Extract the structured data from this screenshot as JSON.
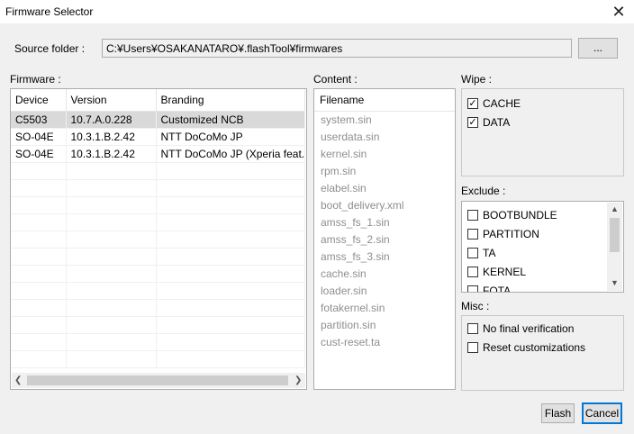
{
  "window": {
    "title": "Firmware Selector",
    "close_icon": "close-icon"
  },
  "source": {
    "label": "Source folder :",
    "path": "C:¥Users¥OSAKANATARO¥.flashTool¥firmwares",
    "browse_label": "..."
  },
  "firmware": {
    "label": "Firmware :",
    "columns": [
      "Device",
      "Version",
      "Branding"
    ],
    "rows": [
      {
        "device": "C5503",
        "version": "10.7.A.0.228",
        "branding": "Customized NCB",
        "selected": true
      },
      {
        "device": "SO-04E",
        "version": "10.3.1.B.2.42",
        "branding": "NTT DoCoMo JP"
      },
      {
        "device": "SO-04E",
        "version": "10.3.1.B.2.42",
        "branding": "NTT DoCoMo JP (Xperia feat. ..."
      }
    ]
  },
  "content": {
    "label": "Content :",
    "header": "Filename",
    "files": [
      "system.sin",
      "userdata.sin",
      "kernel.sin",
      "rpm.sin",
      "elabel.sin",
      "boot_delivery.xml",
      "amss_fs_1.sin",
      "amss_fs_2.sin",
      "amss_fs_3.sin",
      "cache.sin",
      "loader.sin",
      "fotakernel.sin",
      "partition.sin",
      "cust-reset.ta"
    ]
  },
  "wipe": {
    "label": "Wipe :",
    "items": [
      {
        "label": "CACHE",
        "checked": true
      },
      {
        "label": "DATA",
        "checked": true
      }
    ]
  },
  "exclude": {
    "label": "Exclude :",
    "items": [
      {
        "label": "BOOTBUNDLE",
        "checked": false
      },
      {
        "label": "PARTITION",
        "checked": false
      },
      {
        "label": "TA",
        "checked": false
      },
      {
        "label": "KERNEL",
        "checked": false
      },
      {
        "label": "FOTA",
        "checked": false
      }
    ]
  },
  "misc": {
    "label": "Misc :",
    "items": [
      {
        "label": "No final verification",
        "checked": false
      },
      {
        "label": "Reset customizations",
        "checked": false
      }
    ]
  },
  "buttons": {
    "flash": "Flash",
    "cancel": "Cancel"
  }
}
